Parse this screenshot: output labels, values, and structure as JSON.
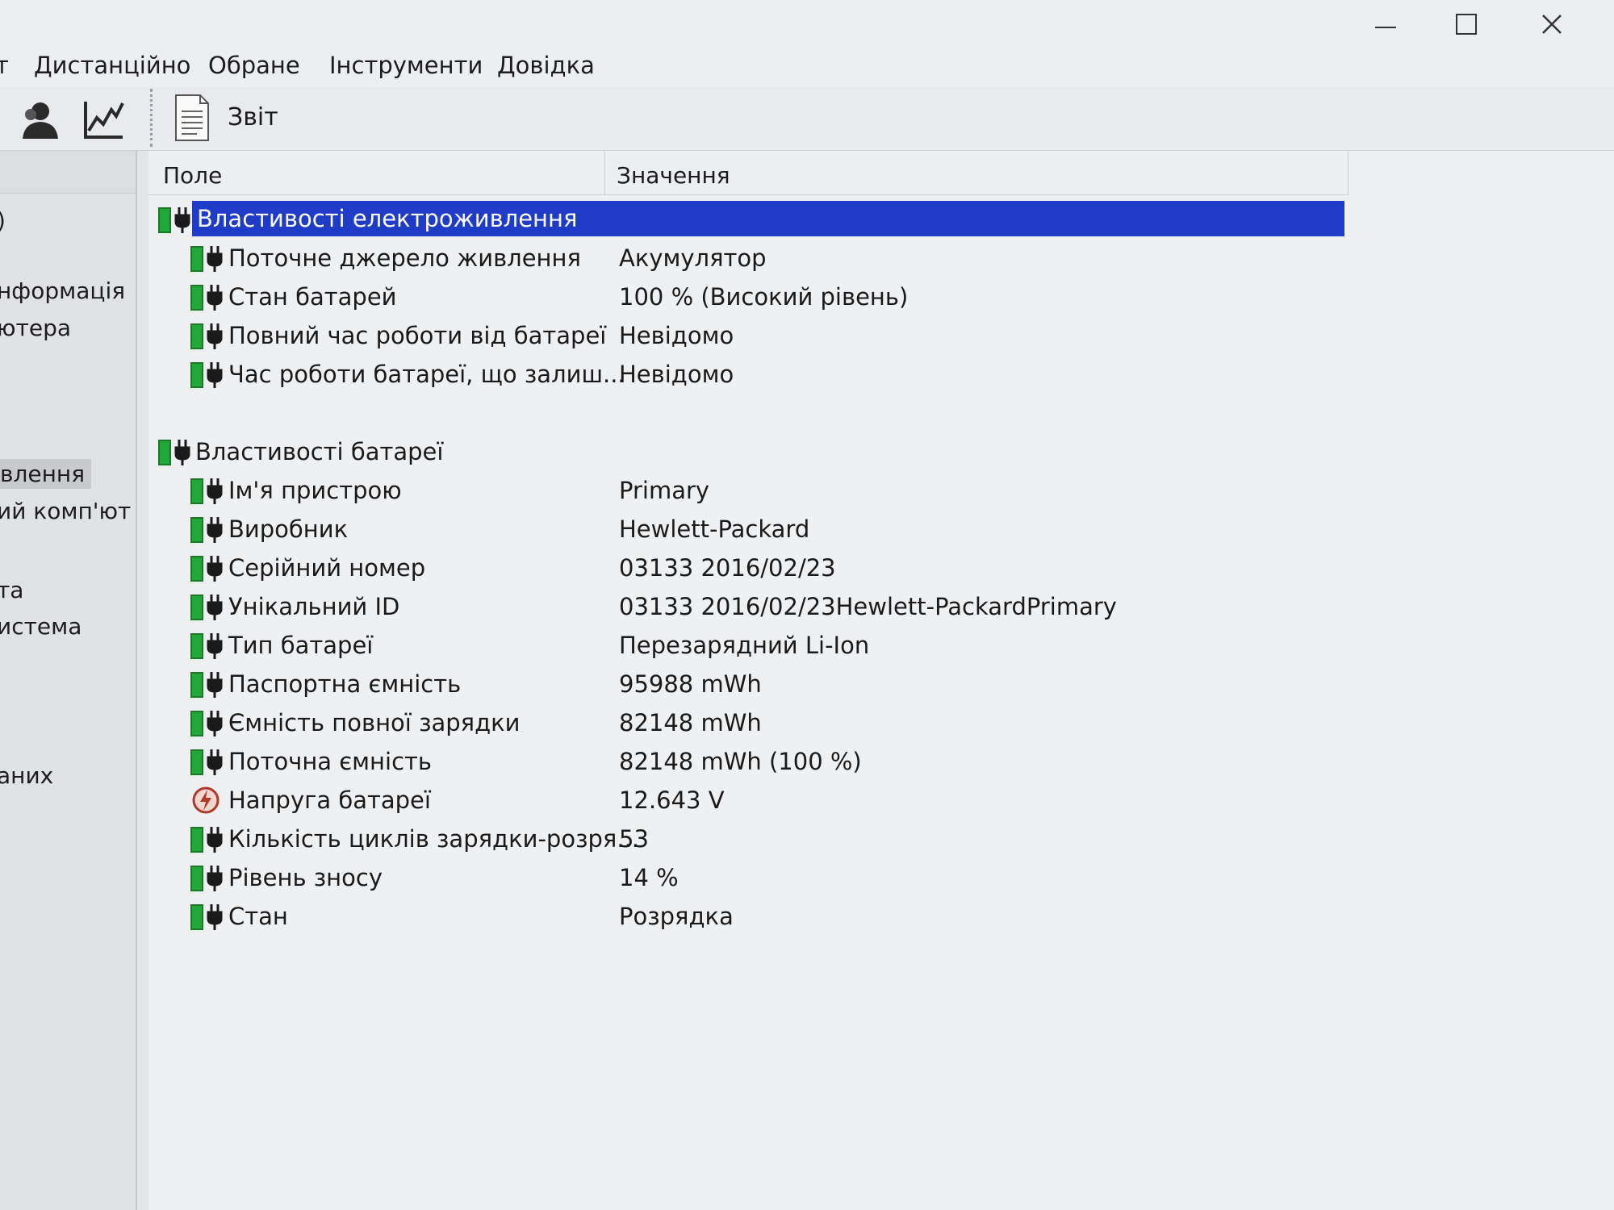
{
  "menu": {
    "items": [
      {
        "label": "т"
      },
      {
        "label": "Дистанційно"
      },
      {
        "label": "Обране"
      },
      {
        "label": "Інструменти"
      },
      {
        "label": "Довідка"
      }
    ]
  },
  "toolbar": {
    "report_label": "Звіт",
    "icons": [
      "user-icon",
      "chart-icon",
      "report-icon"
    ]
  },
  "sidebar": {
    "items": [
      {
        "label": ")"
      },
      {
        "label": "нформація"
      },
      {
        "label": "ютера"
      },
      {
        "label": "влення"
      },
      {
        "label": "ий комп'ют"
      },
      {
        "label": "та"
      },
      {
        "label": "истема"
      },
      {
        "label": "аних"
      }
    ]
  },
  "columns": {
    "field": "Поле",
    "value": "Значення"
  },
  "sections": [
    {
      "title": "Властивості електроживлення",
      "rows": [
        {
          "field": "Поточне джерело живлення",
          "value": "Акумулятор"
        },
        {
          "field": "Стан батарей",
          "value": "100 % (Високий рівень)"
        },
        {
          "field": "Повний час роботи від батареї",
          "value": "Невідомо"
        },
        {
          "field": "Час роботи батареї, що залиш...",
          "value": "Невідомо"
        }
      ]
    },
    {
      "title": "Властивості батареї",
      "rows": [
        {
          "field": "Ім'я пристрою",
          "value": "Primary"
        },
        {
          "field": "Виробник",
          "value": "Hewlett-Packard"
        },
        {
          "field": "Серійний номер",
          "value": "03133 2016/02/23"
        },
        {
          "field": "Унікальний ID",
          "value": "03133 2016/02/23Hewlett-PackardPrimary"
        },
        {
          "field": "Тип батареї",
          "value": "Перезарядний Li-Ion"
        },
        {
          "field": "Паспортна ємність",
          "value": "95988 mWh"
        },
        {
          "field": "Ємність повної зарядки",
          "value": "82148 mWh"
        },
        {
          "field": "Поточна ємність",
          "value": "82148 mWh  (100 %)"
        },
        {
          "field": "Напруга батареї",
          "value": "12.643 V"
        },
        {
          "field": "Кількість циклів зарядки-розря...",
          "value": "53"
        },
        {
          "field": "Рівень зносу",
          "value": "14 %"
        },
        {
          "field": "Стан",
          "value": "Розрядка"
        }
      ]
    }
  ],
  "colors": {
    "selection": "#1f3cc8",
    "battery_green": "#1faa2e",
    "voltage_red": "#c0392b"
  }
}
